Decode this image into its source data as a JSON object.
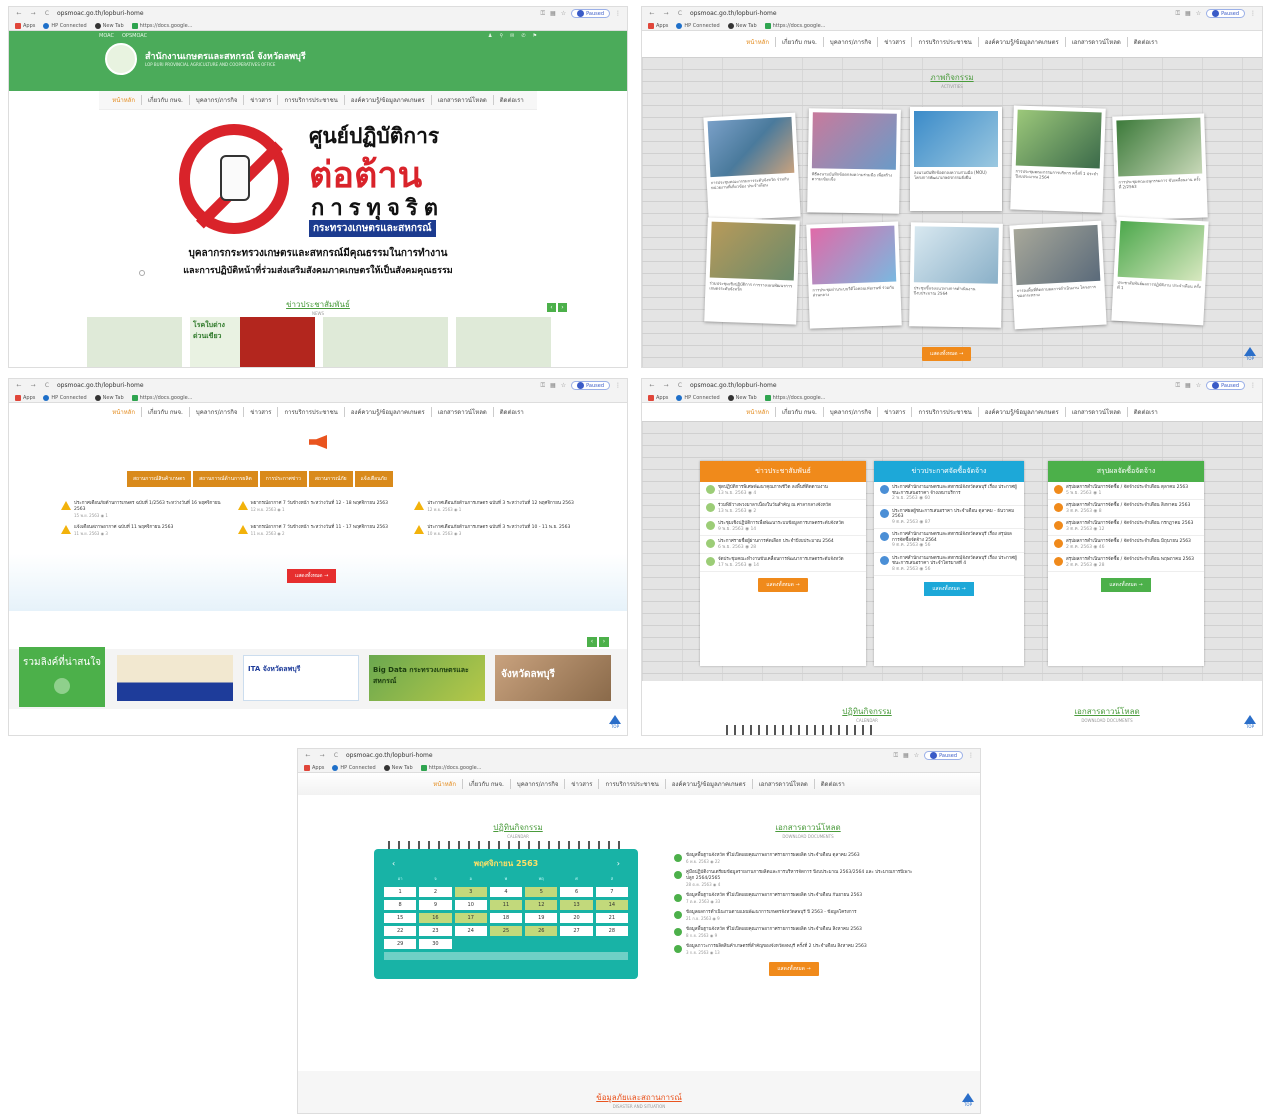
{
  "browser": {
    "url": "opsmoac.go.th/lopburi-home",
    "profile": "Paused",
    "bookmarks": [
      "Apps",
      "HP Connected",
      "New Tab",
      "https://docs.google..."
    ]
  },
  "menu": [
    "หน้าหลัก",
    "เกี่ยวกับ กษจ.",
    "บุคลากร/ภารกิจ",
    "ข่าวสาร",
    "การบริการประชาชน",
    "องค์ความรู้/ข้อมูลภาคเกษตร",
    "เอกสารดาวน์โหลด",
    "ติดต่อเรา"
  ],
  "panel1": {
    "toplinks": [
      "MOAC",
      "OPSMOAC"
    ],
    "org_title": "สำนักงานเกษตรและสหกรณ์ จังหวัดลพบุรี",
    "org_sub": "LOP BURI PROVINCIAL AGRICULTURE AND COOPERATIVES OFFICE",
    "banner_line1": "ศูนย์ปฏิบัติการ",
    "banner_line2": "ต่อต้าน",
    "banner_line3": "การทุจริต",
    "banner_ministry": "กระทรวงเกษตรและสหกรณ์",
    "slogan1": "บุคลากรกระทรวงเกษตรและสหกรณ์มีคุณธรรมในการทำงาน",
    "slogan2": "และการปฏิบัติหน้าที่ร่วมส่งเสริมสังคมภาคเกษตรให้เป็นสังคมคุณธรรม",
    "section": "ข่าวประชาสัมพันธ์",
    "section_sub": "NEWS",
    "card_text": "โรคใบด่างด่วนเขียว"
  },
  "panel2": {
    "section": "ภาพกิจกรรม",
    "section_sub": "ACTIVITIES",
    "photos": [
      "การประชุมคณะกรรมการระดับจังหวัด ร่วมกับหน่วยงานที่เกี่ยวข้อง ประจำเดือน",
      "พิธีลงนามบันทึกข้อตกลงความร่วมมือ เพื่อสร้างความเข้มแข็ง",
      "ลงนามบันทึกข้อตกลงความร่วมมือ (MOU) โครงการพัฒนาเกษตรกรรมยั่งยืน",
      "การประชุมคณะกรรมการบริหาร ครั้งที่ 1 ประจำปีงบประมาณ 2564",
      "การประชุมคณะอนุกรรมการ ขับเคลื่อนงาน ครั้งที่ 2/2563",
      "ร่วมประชุมเชิงปฏิบัติการ การวางแผนพัฒนาการเกษตรระดับจังหวัด",
      "การประชุมผ่านระบบวีดีโอคอนเฟอเรนซ์ ร่วมกับส่วนกลาง",
      "ประชุมชี้แจงแนวทางการดำเนินงาน ปีงบประมาณ 2564",
      "การลงพื้นที่ติดตามผลการดำเนินงาน โครงการของกระทรวง",
      "ประชาสัมพันธ์ผลการปฏิบัติงาน ประจำเดือน ครั้งที่ 1"
    ],
    "more": "แสดงทั้งหมด →"
  },
  "panel3": {
    "tabs": [
      "สถานการณ์สินค้าเกษตร",
      "สถานการณ์ด้านการผลิต",
      "การประกาศข่าว",
      "สถานการณ์ภัย",
      "แจ้งเตือนภัย"
    ],
    "notices": [
      {
        "text": "ประกาศเตือนภัยด้านการเกษตร ฉบับที่ 1/2563 ระหว่างวันที่ 16 พฤศจิกายน 2563",
        "date": "15 พ.ย. 2563",
        "views": "1"
      },
      {
        "text": "พยากรณ์อากาศ 7 วันข้างหน้า ระหว่างวันที่ 12 - 18 พฤศจิกายน 2563",
        "date": "12 พ.ย. 2563",
        "views": "1"
      },
      {
        "text": "ประกาศเตือนภัยด้านการเกษตร ฉบับที่ 3 ระหว่างวันที่ 12 พฤศจิกายน 2563",
        "date": "12 พ.ย. 2563",
        "views": "1"
      },
      {
        "text": "แจ้งเตือนสภาพอากาศ ฉบับที่ 11 พฤศจิกายน 2563",
        "date": "11 พ.ย. 2563",
        "views": "3"
      },
      {
        "text": "พยากรณ์อากาศ 7 วันข้างหน้า ระหว่างวันที่ 11 - 17 พฤศจิกายน 2563",
        "date": "11 พ.ย. 2563",
        "views": "2"
      },
      {
        "text": "ประกาศเตือนภัยด้านการเกษตร ฉบับที่ 3 ระหว่างวันที่ 10 - 11 พ.ย. 2563",
        "date": "10 พ.ย. 2563",
        "views": "3"
      }
    ],
    "more": "แสดงทั้งหมด →",
    "links_title": "รวมลิงค์ที่น่าสนใจ",
    "links": [
      "",
      "ITA จังหวัดลพบุรี",
      "Big Data กระทรวงเกษตรและสหกรณ์",
      "จังหวัดลพบุรี"
    ]
  },
  "panel4": {
    "cols": [
      {
        "title": "ข่าวประชาสัมพันธ์",
        "items": [
          {
            "text": "ชุดปฏิบัติการพิเศษพัฒนาคุณภาพชีวิต ลงพื้นที่ติดตามงาน",
            "date": "13 พ.ย. 2563",
            "views": "4"
          },
          {
            "text": "ร่วมพิธีวางพวงมาลาเนื่องในวันสำคัญ ณ ศาลากลางจังหวัด",
            "date": "13 พ.ย. 2563",
            "views": "2"
          },
          {
            "text": "ประชุมเชิงปฏิบัติการเพื่อพัฒนาระบบข้อมูลการเกษตรระดับจังหวัด",
            "date": "9 พ.ย. 2563",
            "views": "14"
          },
          {
            "text": "ประกาศรายชื่อผู้ผ่านการคัดเลือก ประจำปีงบประมาณ 2564",
            "date": "6 พ.ย. 2563",
            "views": "28"
          },
          {
            "text": "จัดประชุมคณะทำงานขับเคลื่อนการพัฒนาการเกษตรระดับจังหวัด",
            "date": "17 พ.ย. 2563",
            "views": "14"
          }
        ],
        "more": "แสดงทั้งหมด →"
      },
      {
        "title": "ข่าวประกาศจัดซื้อจัดจ้าง",
        "items": [
          {
            "text": "ประกาศสำนักงานเกษตรและสหกรณ์จังหวัดลพบุรี เรื่อง ประกาศผู้ชนะการเสนอราคา จ้างเหมาบริการ",
            "date": "2 พ.ย. 2563",
            "views": "60"
          },
          {
            "text": "ประกาศผลผู้ชนะการเสนอราคา ประจำเดือน ตุลาคม - ธันวาคม 2563",
            "date": "9 ต.ค. 2563",
            "views": "87"
          },
          {
            "text": "ประกาศสำนักงานเกษตรและสหกรณ์จังหวัดลพบุรี เรื่อง สรุปผลการจัดซื้อจัดจ้าง 2564",
            "date": "9 ต.ค. 2563",
            "views": "56"
          },
          {
            "text": "ประกาศสำนักงานเกษตรและสหกรณ์จังหวัดลพบุรี เรื่อง ประกาศผู้ชนะการเสนอราคา ประจำไตรมาสที่ 4",
            "date": "8 ต.ค. 2563",
            "views": "56"
          }
        ],
        "more": "แสดงทั้งหมด →"
      },
      {
        "title": "สรุปผลจัดซื้อจัดจ้าง",
        "items": [
          {
            "text": "สรุปผลการดำเนินการจัดซื้อ / จัดจ้างประจำเดือน ตุลาคม 2563",
            "date": "5 พ.ย. 2563",
            "views": "1"
          },
          {
            "text": "สรุปผลการดำเนินการจัดซื้อ / จัดจ้างประจำเดือน สิงหาคม 2563",
            "date": "3 ต.ค. 2563",
            "views": "8"
          },
          {
            "text": "สรุปผลการดำเนินการจัดซื้อ / จัดจ้างประจำเดือน กรกฎาคม 2563",
            "date": "3 ต.ค. 2563",
            "views": "12"
          },
          {
            "text": "สรุปผลการดำเนินการจัดซื้อ / จัดจ้างประจำเดือน มิถุนายน 2563",
            "date": "2 ต.ค. 2563",
            "views": "46"
          },
          {
            "text": "สรุปผลการดำเนินการจัดซื้อ / จัดจ้างประจำเดือน พฤษภาคม 2563",
            "date": "2 ต.ค. 2563",
            "views": "28"
          }
        ],
        "more": "แสดงทั้งหมด →"
      }
    ],
    "cal_title": "ปฏิทินกิจกรรม",
    "cal_sub": "CALENDAR",
    "dl_title": "เอกสารดาวน์โหลด",
    "dl_sub": "DOWNLOAD DOCUMENTS"
  },
  "panel5": {
    "cal_title": "ปฏิทินกิจกรรม",
    "cal_sub": "CALENDAR",
    "month": "พฤศจิกายน 2563",
    "dow": [
      "อา",
      "จ",
      "อ",
      "พ",
      "พฤ",
      "ศ",
      "ส"
    ],
    "days": [
      [
        "1",
        "2",
        "3",
        "4",
        "5",
        "6",
        "7"
      ],
      [
        "8",
        "9",
        "10",
        "11",
        "12",
        "13",
        "14"
      ],
      [
        "15",
        "16",
        "17",
        "18",
        "19",
        "20",
        "21"
      ],
      [
        "22",
        "23",
        "24",
        "25",
        "26",
        "27",
        "28"
      ],
      [
        "29",
        "30",
        "",
        "",
        "",
        "",
        ""
      ]
    ],
    "events": [
      "3",
      "5",
      "11",
      "12",
      "13",
      "14",
      "16",
      "17",
      "25",
      "26"
    ],
    "dl_title": "เอกสารดาวน์โหลด",
    "dl_sub": "DOWNLOAD DOCUMENTS",
    "docs": [
      {
        "text": "ข้อมูลพื้นฐานจังหวัด ที่ไม่เปิดเผยคุณภาพอากาศรายการผลผลิต ประจำเดือน ตุลาคม 2563",
        "date": "6 พ.ย. 2563",
        "views": "22"
      },
      {
        "text": "คู่มือปฏิบัติงานเตรียมข้อมูลรายงานการผลิตและการบริหารจัดการ ปีงบประมาณ 2563/2564 และ ประมาณการปีเพาะปลูก 2564/2565",
        "date": "28 ต.ค. 2563",
        "views": "4"
      },
      {
        "text": "ข้อมูลพื้นฐานจังหวัด ที่ไม่เปิดเผยคุณภาพอากาศรายการผลผลิต ประจำเดือน กันยายน 2563",
        "date": "7 ต.ค. 2563",
        "views": "33"
      },
      {
        "text": "ข้อมูลผลการดำเนินงานตามแผนพัฒนาการเกษตรจังหวัดลพบุรี ปี 2563 - ข้อมูลโครงการ",
        "date": "21 ก.ย. 2563",
        "views": "9"
      },
      {
        "text": "ข้อมูลพื้นฐานจังหวัด ที่ไม่เปิดเผยคุณภาพอากาศรายการผลผลิต ประจำเดือน สิงหาคม 2563",
        "date": "8 ก.ย. 2563",
        "views": "9"
      },
      {
        "text": "ข้อมูลภาวะการผลิตสินค้าเกษตรที่สำคัญของจังหวัดลพบุรี ครั้งที่ 2 ประจำเดือน สิงหาคม 2563",
        "date": "3 ก.ย. 2563",
        "views": "13"
      }
    ],
    "more": "แสดงทั้งหมด →",
    "disaster": "ข้อมูลภัยและสถานการณ์",
    "disaster_sub": "DISASTER AND SITUATION"
  },
  "top_label": "TOP"
}
